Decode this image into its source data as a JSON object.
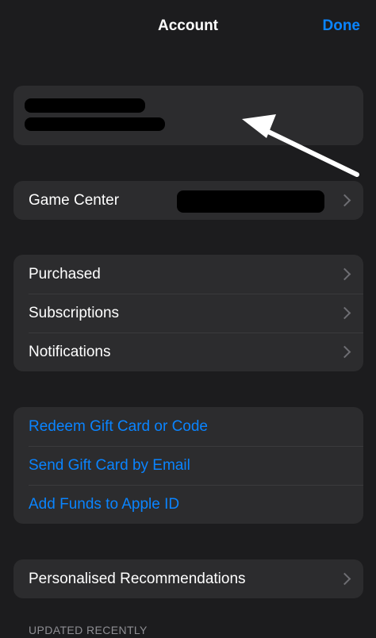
{
  "header": {
    "title": "Account",
    "done_label": "Done"
  },
  "game_center": {
    "label": "Game Center"
  },
  "store_group": {
    "items": [
      {
        "label": "Purchased"
      },
      {
        "label": "Subscriptions"
      },
      {
        "label": "Notifications"
      }
    ]
  },
  "gift_group": {
    "items": [
      {
        "label": "Redeem Gift Card or Code"
      },
      {
        "label": "Send Gift Card by Email"
      },
      {
        "label": "Add Funds to Apple ID"
      }
    ]
  },
  "recommendations": {
    "label": "Personalised Recommendations"
  },
  "updated_section": {
    "header": "UPDATED RECENTLY"
  },
  "colors": {
    "background": "#1c1c1e",
    "cell": "#2c2c2e",
    "accent": "#0a84ff",
    "secondary_text": "#8e8e93"
  },
  "icons": [
    "chevron-right-icon",
    "annotation-arrow"
  ]
}
